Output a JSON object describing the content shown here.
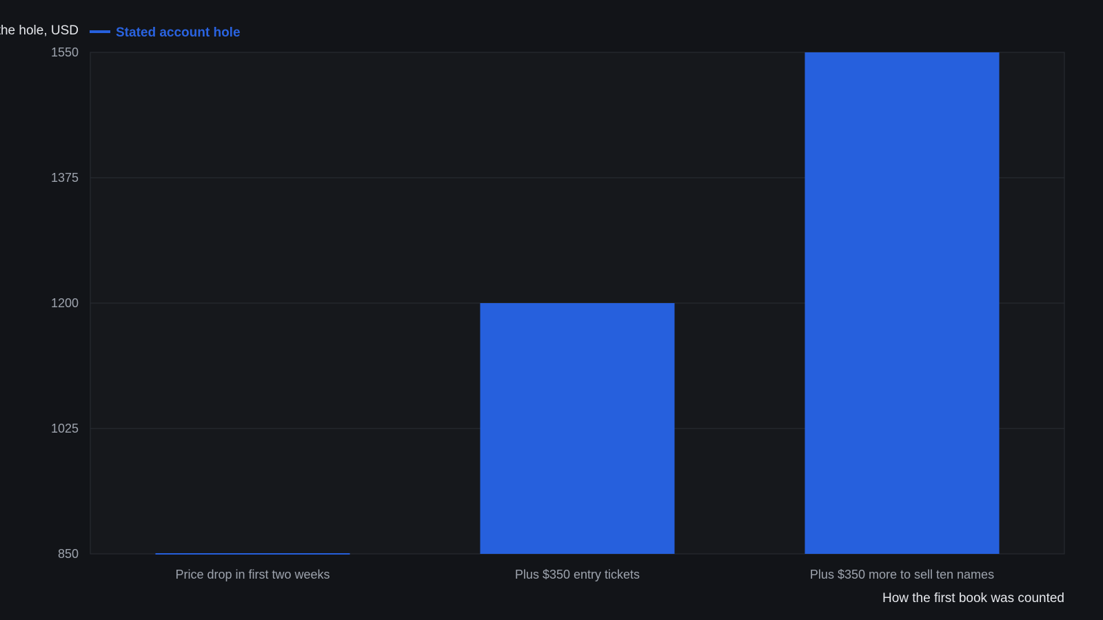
{
  "colors": {
    "background": "#121418",
    "plot_background": "#16181c",
    "grid": "#2a2e35",
    "bar": "#2660dd",
    "legend_text": "#2a63e0",
    "axis_text": "#9da3ad",
    "label_text": "#e6e8ec"
  },
  "chart_data": {
    "type": "bar",
    "title": "",
    "ylabel": "the hole, USD",
    "xlabel": "How the first book was counted",
    "ylim": [
      850,
      1550
    ],
    "yticks": [
      850,
      1025,
      1200,
      1375,
      1550
    ],
    "grid": true,
    "legend_position": "top-left",
    "categories": [
      "Price drop in first two weeks",
      "Plus $350 entry tickets",
      "Plus $350 more to sell ten names"
    ],
    "series": [
      {
        "name": "Stated account hole",
        "values": [
          850,
          1200,
          1550
        ]
      }
    ]
  }
}
